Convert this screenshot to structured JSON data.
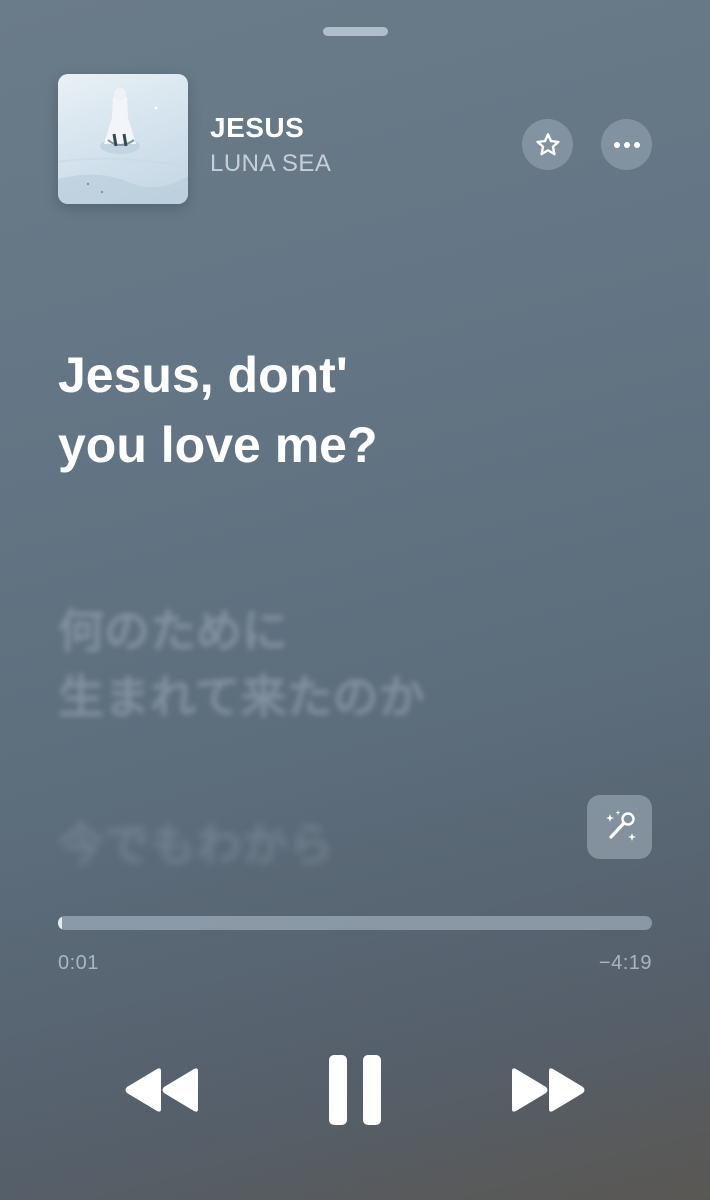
{
  "now_playing": {
    "title": "JESUS",
    "artist": "LUNA SEA",
    "progress_fraction": 0.004,
    "elapsed": "0:01",
    "remaining": "−4:19"
  },
  "lyrics": {
    "active_lines": [
      "Jesus, dont'",
      "you love me?"
    ],
    "next_lines": [
      "何のために",
      "生まれて来たのか"
    ],
    "later_lines": [
      "今でもわから"
    ]
  },
  "icons": {
    "artwork": "album-artwork",
    "favorite": "star-icon",
    "more": "ellipsis-icon",
    "sing": "microphone-sparkle-icon",
    "rewind": "rewind-icon",
    "pause": "pause-icon",
    "forward": "fast-forward-icon"
  },
  "colors": {
    "text_primary": "#ffffff",
    "progress_fill": "#ebf0f6"
  }
}
